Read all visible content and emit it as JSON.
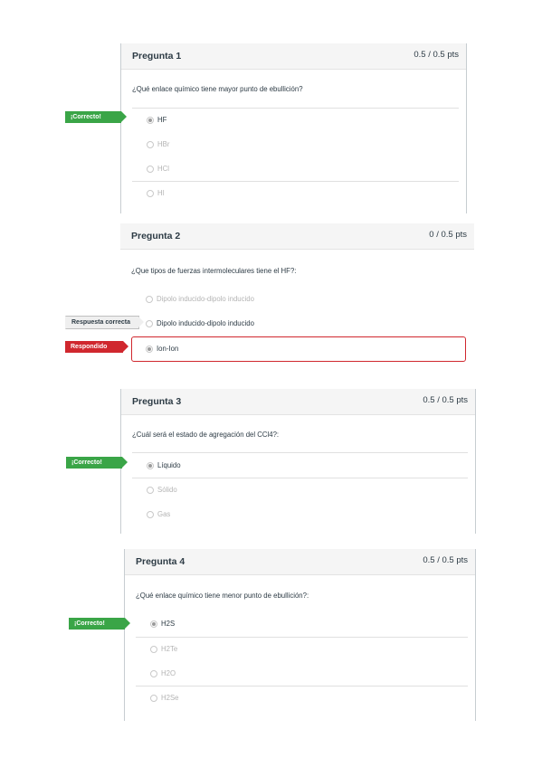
{
  "questions": [
    {
      "title": "Pregunta 1",
      "points": "0.5 / 0.5 pts",
      "text": "¿Qué enlace químico tiene mayor punto de ebullición?",
      "answers": [
        "HF",
        "HBr",
        "HCl",
        "HI"
      ],
      "flags": {
        "correct": "¡Correcto!"
      }
    },
    {
      "title": "Pregunta 2",
      "points": "0 / 0.5 pts",
      "text": "¿Que tipos de fuerzas intermoleculares tiene el HF?:",
      "answers": [
        "Dipolo inducido-dipolo inducido",
        "Dipolo inducido-dipolo inducido",
        "Ion-Ion"
      ],
      "flags": {
        "correct_answer": "Respuesta correcta",
        "answered": "Respondido"
      }
    },
    {
      "title": "Pregunta 3",
      "points": "0.5 / 0.5 pts",
      "text": "¿Cuál será el estado de agregación del CCl4?:",
      "answers": [
        "Líquido",
        "Sólido",
        "Gas"
      ],
      "flags": {
        "correct": "¡Correcto!"
      }
    },
    {
      "title": "Pregunta 4",
      "points": "0.5 / 0.5 pts",
      "text": "¿Qué enlace químico tiene menor punto de ebullición?:",
      "answers": [
        "H2S",
        "H2Te",
        "H2O",
        "H2Se"
      ],
      "flags": {
        "correct": "¡Correcto!"
      }
    }
  ],
  "colors": {
    "correct": "#3aa547",
    "incorrect": "#d0272e"
  }
}
